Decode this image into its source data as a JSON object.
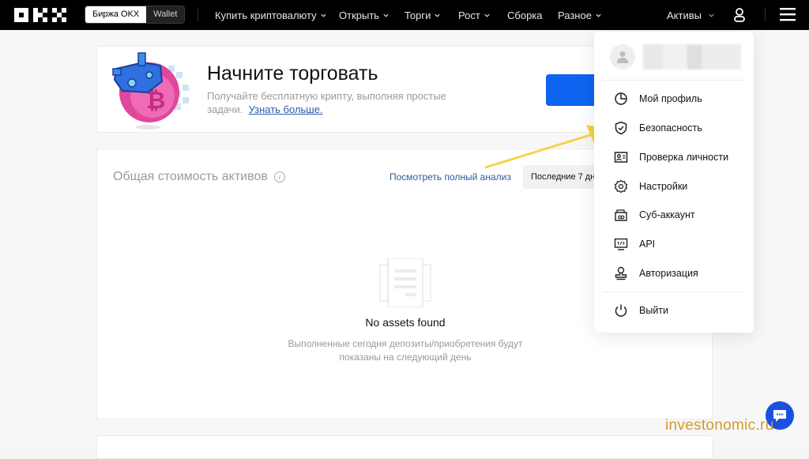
{
  "header": {
    "brand": "OKX",
    "switch": {
      "exchange_label": "Биржа OKX",
      "wallet_label": "Wallet"
    },
    "nav": [
      {
        "label": "Купить криптовалюту",
        "has_dropdown": true
      },
      {
        "label": "Открыть",
        "has_dropdown": true
      },
      {
        "label": "Торги",
        "has_dropdown": true
      },
      {
        "label": "Рост",
        "has_dropdown": true
      },
      {
        "label": "Сборка",
        "has_dropdown": false
      },
      {
        "label": "Разное",
        "has_dropdown": true
      }
    ],
    "assets_label": "Активы",
    "icons": {
      "user": "user-icon",
      "menu": "hamburger-menu-icon"
    }
  },
  "promo": {
    "title": "Начните торговать",
    "subtitle": "Получайте бесплатную крипту, выполняя простые задачи.",
    "link": "Узнать больше.",
    "button_color": "#0c64f0"
  },
  "assets": {
    "title": "Общая стоимость активов",
    "analysis_link": "Посмотреть полный анализ",
    "period": "Последние 7 дней",
    "empty_title": "No assets found",
    "empty_subtitle_1": "Выполненные сегодня депозиты/приобретения будут",
    "empty_subtitle_2": "показаны на следующий день"
  },
  "user_menu": {
    "items": [
      {
        "label": "Мой профиль",
        "icon": "pie-chart-icon"
      },
      {
        "label": "Безопасность",
        "icon": "shield-check-icon"
      },
      {
        "label": "Проверка личности",
        "icon": "id-card-icon"
      },
      {
        "label": "Настройки",
        "icon": "gear-icon"
      },
      {
        "label": "Суб-аккаунт",
        "icon": "sub-account-icon"
      },
      {
        "label": "API",
        "icon": "api-icon"
      },
      {
        "label": "Авторизация",
        "icon": "stamp-icon"
      }
    ],
    "logout": {
      "label": "Выйти",
      "icon": "power-icon"
    }
  },
  "annotation": {
    "arrow_color": "#f5d442"
  },
  "watermark": "investonomic.ru",
  "chat": {
    "icon": "chat-icon",
    "color": "#1a50e0"
  }
}
